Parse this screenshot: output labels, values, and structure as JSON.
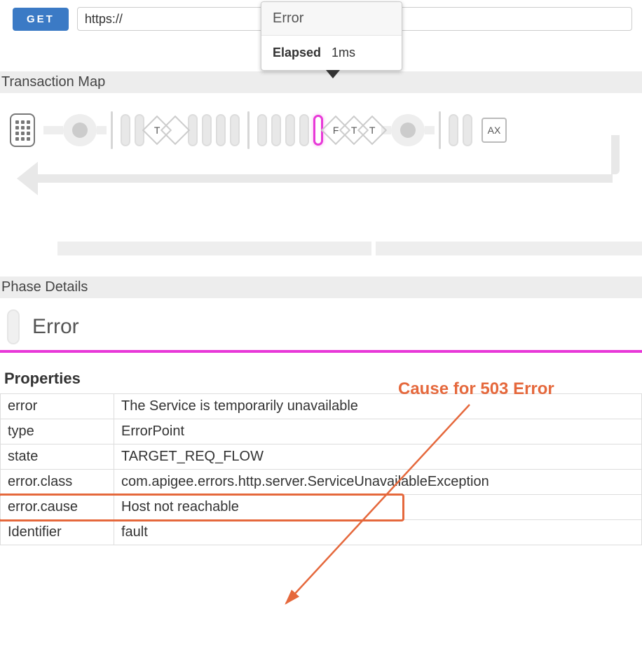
{
  "top": {
    "method": "GET",
    "url": "https://"
  },
  "tooltip": {
    "title": "Error",
    "elapsed_label": "Elapsed",
    "elapsed_value": "1ms"
  },
  "sections": {
    "transaction_map": "Transaction Map",
    "phase_details": "Phase Details"
  },
  "flow": {
    "diamonds": [
      "T",
      "",
      "",
      "",
      "",
      "F",
      "T",
      "T"
    ],
    "ax": "AX"
  },
  "phase": {
    "title": "Error"
  },
  "annotation": "Cause for 503 Error",
  "props": {
    "header": "Properties",
    "rows": [
      {
        "k": "error",
        "v": "The Service is temporarily unavailable"
      },
      {
        "k": "type",
        "v": "ErrorPoint"
      },
      {
        "k": "state",
        "v": "TARGET_REQ_FLOW"
      },
      {
        "k": "error.class",
        "v": "com.apigee.errors.http.server.ServiceUnavailableException"
      },
      {
        "k": "error.cause",
        "v": "Host not reachable"
      },
      {
        "k": "Identifier",
        "v": "fault"
      }
    ]
  }
}
